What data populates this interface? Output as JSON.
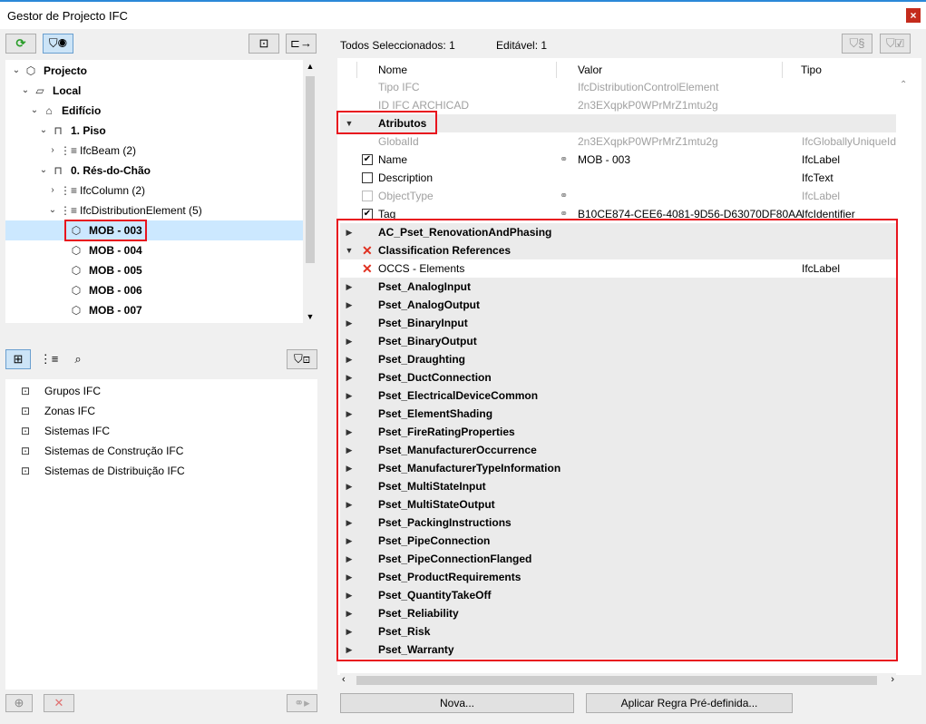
{
  "window": {
    "title": "Gestor de Projecto IFC",
    "close": "×"
  },
  "tree": [
    {
      "label": "Projecto",
      "bold": true,
      "caret": "⌄",
      "icon": "⬡",
      "x": 0,
      "y": 0
    },
    {
      "label": "Local",
      "bold": true,
      "caret": "⌄",
      "icon": "▱",
      "x": 1,
      "y": 1
    },
    {
      "label": "Edifício",
      "bold": true,
      "caret": "⌄",
      "icon": "⌂",
      "x": 2,
      "y": 2
    },
    {
      "label": "1. Piso",
      "bold": true,
      "caret": "⌄",
      "icon": "⊓",
      "x": 3,
      "y": 3
    },
    {
      "label": "IfcBeam (2)",
      "bold": false,
      "caret": "›",
      "icon": "⋮≡",
      "x": 4,
      "y": 4
    },
    {
      "label": "0. Rés-do-Chão",
      "bold": true,
      "caret": "⌄",
      "icon": "⊓",
      "x": 3,
      "y": 5
    },
    {
      "label": "IfcColumn (2)",
      "bold": false,
      "caret": "›",
      "icon": "⋮≡",
      "x": 4,
      "y": 6
    },
    {
      "label": "IfcDistributionElement (5)",
      "bold": false,
      "caret": "⌄",
      "icon": "⋮≡",
      "x": 4,
      "y": 7
    },
    {
      "label": "MOB - 003",
      "bold": true,
      "caret": "",
      "icon": "⬡",
      "x": 5,
      "y": 8,
      "selected": true
    },
    {
      "label": "MOB - 004",
      "bold": true,
      "caret": "",
      "icon": "⬡",
      "x": 5,
      "y": 9
    },
    {
      "label": "MOB - 005",
      "bold": true,
      "caret": "",
      "icon": "⬡",
      "x": 5,
      "y": 10
    },
    {
      "label": "MOB - 006",
      "bold": true,
      "caret": "",
      "icon": "⬡",
      "x": 5,
      "y": 11
    },
    {
      "label": "MOB - 007",
      "bold": true,
      "caret": "",
      "icon": "⬡",
      "x": 5,
      "y": 12
    }
  ],
  "lower_list": [
    {
      "label": "Grupos IFC",
      "icon": "group-icon"
    },
    {
      "label": "Zonas IFC",
      "icon": "zone-icon"
    },
    {
      "label": "Sistemas IFC",
      "icon": "system-icon"
    },
    {
      "label": "Sistemas de Construção IFC",
      "icon": "building-system-icon"
    },
    {
      "label": "Sistemas de Distribuição IFC",
      "icon": "distribution-system-icon"
    }
  ],
  "status": {
    "selected": "Todos Seleccionados: 1",
    "editable": "Editável: 1"
  },
  "columns": {
    "name": "Nome",
    "value": "Valor",
    "type": "Tipo"
  },
  "rows": [
    {
      "kind": "grey",
      "name": "Tipo IFC",
      "value": "IfcDistributionControlElement",
      "type": ""
    },
    {
      "kind": "grey",
      "name": "ID IFC ARCHICAD",
      "value": "2n3EXqpkP0WPrMrZ1mtu2g",
      "type": ""
    },
    {
      "kind": "group-open",
      "name": "Atributos"
    },
    {
      "kind": "grey",
      "name": "GlobalId",
      "value": "2n3EXqpkP0WPrMrZ1mtu2g",
      "type": "IfcGloballyUniqueId"
    },
    {
      "kind": "check",
      "checked": true,
      "name": "Name",
      "link": true,
      "value": "MOB - 003",
      "type": "IfcLabel"
    },
    {
      "kind": "check",
      "checked": false,
      "name": "Description",
      "value": "",
      "type": "IfcText"
    },
    {
      "kind": "check-dis",
      "checked": false,
      "name": "ObjectType",
      "link": true,
      "value": "",
      "type": "IfcLabel"
    },
    {
      "kind": "check",
      "checked": true,
      "name": "Tag",
      "link": true,
      "value": "B10CE874-CEE6-4081-9D56-D63070DF80AA",
      "type": "IfcIdentifier"
    },
    {
      "kind": "group",
      "name": "AC_Pset_RenovationAndPhasing"
    },
    {
      "kind": "group-open-x",
      "name": "Classification References"
    },
    {
      "kind": "x",
      "name": "OCCS - Elements",
      "value": "",
      "type": "IfcLabel"
    },
    {
      "kind": "group",
      "name": "Pset_AnalogInput"
    },
    {
      "kind": "group",
      "name": "Pset_AnalogOutput"
    },
    {
      "kind": "group",
      "name": "Pset_BinaryInput"
    },
    {
      "kind": "group",
      "name": "Pset_BinaryOutput"
    },
    {
      "kind": "group",
      "name": "Pset_Draughting"
    },
    {
      "kind": "group",
      "name": "Pset_DuctConnection"
    },
    {
      "kind": "group",
      "name": "Pset_ElectricalDeviceCommon"
    },
    {
      "kind": "group",
      "name": "Pset_ElementShading"
    },
    {
      "kind": "group",
      "name": "Pset_FireRatingProperties"
    },
    {
      "kind": "group",
      "name": "Pset_ManufacturerOccurrence"
    },
    {
      "kind": "group",
      "name": "Pset_ManufacturerTypeInformation"
    },
    {
      "kind": "group",
      "name": "Pset_MultiStateInput"
    },
    {
      "kind": "group",
      "name": "Pset_MultiStateOutput"
    },
    {
      "kind": "group",
      "name": "Pset_PackingInstructions"
    },
    {
      "kind": "group",
      "name": "Pset_PipeConnection"
    },
    {
      "kind": "group",
      "name": "Pset_PipeConnectionFlanged"
    },
    {
      "kind": "group",
      "name": "Pset_ProductRequirements"
    },
    {
      "kind": "group",
      "name": "Pset_QuantityTakeOff"
    },
    {
      "kind": "group",
      "name": "Pset_Reliability"
    },
    {
      "kind": "group",
      "name": "Pset_Risk"
    },
    {
      "kind": "group",
      "name": "Pset_Warranty"
    }
  ],
  "buttons": {
    "new": "Nova...",
    "apply": "Aplicar Regra Pré-definida..."
  },
  "colors": {
    "highlight": "#e8141e",
    "selection": "#cce8ff",
    "accent": "#2b88d8"
  }
}
